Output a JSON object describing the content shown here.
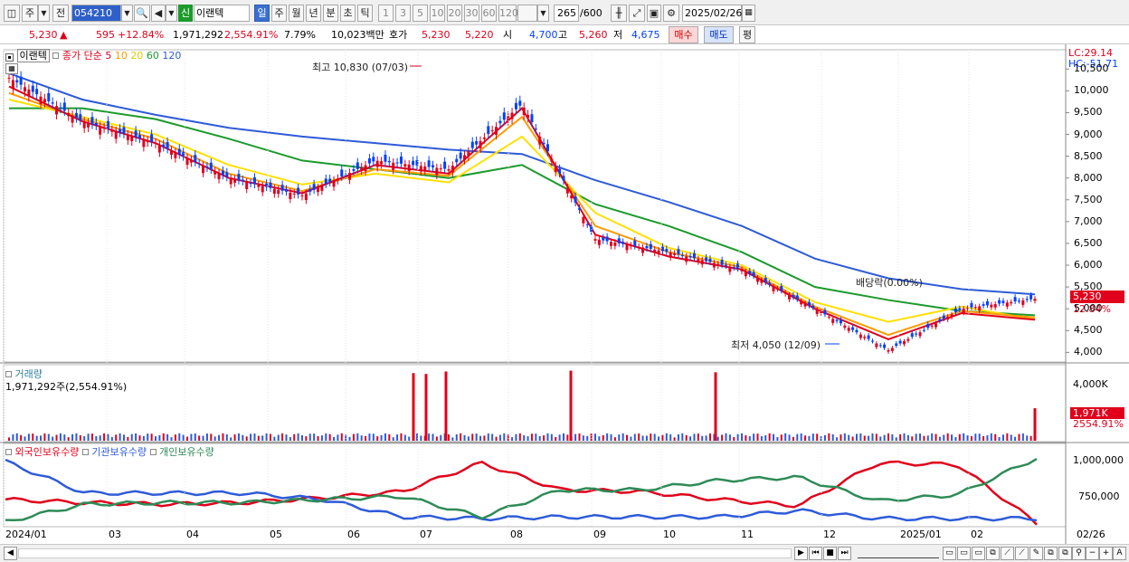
{
  "toolbar": {
    "period_main": "주",
    "period_prev": "전",
    "code": "054210",
    "badge": "신",
    "name": "이랜텍",
    "periods": [
      "일",
      "주",
      "월",
      "년",
      "분",
      "초",
      "틱"
    ],
    "counts": [
      "1",
      "3",
      "5",
      "10",
      "20",
      "30",
      "60",
      "120"
    ],
    "range": "265",
    "range_total": "/600",
    "date": "2025/02/26"
  },
  "quote": {
    "price": "5,230",
    "change": "595",
    "change_pct": "+12.84%",
    "volume": "1,971,292",
    "vol_ratio": "2,554.91%",
    "turnover": "7.79%",
    "amount": "10,023백만",
    "bid_label": "호가",
    "ask": "5,230",
    "bid": "5,220",
    "open_label": "시",
    "open": "4,700",
    "high_label": "고",
    "high": "5,260",
    "low_label": "저",
    "low": "4,675",
    "buy": "매수",
    "sell": "매도",
    "eval": "평"
  },
  "price_pane": {
    "stock": "이랜텍",
    "legend_label": "종가 단순",
    "ma": [
      {
        "p": "5",
        "c": "#e0001b"
      },
      {
        "p": "10",
        "c": "#ff9a00"
      },
      {
        "p": "20",
        "c": "#ffe000"
      },
      {
        "p": "60",
        "c": "#1c9a2c"
      },
      {
        "p": "120",
        "c": "#2e5bd8"
      }
    ],
    "lc": "LC:29.14",
    "hc": "HC:-51.71",
    "high_note": "최고 10,830 (07/03)",
    "low_note": "최저 4,050 (12/09)",
    "div_note": "배당락(0.00%)",
    "last_tag": "5,230",
    "last_pct": "12.84%",
    "y_ticks": [
      "10,500",
      "10,000",
      "9,500",
      "9,000",
      "8,500",
      "8,000",
      "7,500",
      "7,000",
      "6,500",
      "6,000",
      "5,500",
      "5,000",
      "4,500",
      "4,000"
    ]
  },
  "volume_pane": {
    "title": "거래량",
    "value": "1,971,292주(2,554.91%)",
    "tick": "4,000K",
    "last_tag": "1,971K",
    "last_pct": "2554.91%"
  },
  "holder_pane": {
    "series": [
      {
        "name": "외국인보유수량",
        "color": "#e0001b"
      },
      {
        "name": "기관보유수량",
        "color": "#2e5bd8"
      },
      {
        "name": "개인보유수량",
        "color": "#2e8b57"
      }
    ],
    "ticks": [
      "1,000,000",
      "750,000"
    ]
  },
  "x_axis": {
    "labels": [
      "2024/01",
      "03",
      "04",
      "05",
      "06",
      "07",
      "08",
      "09",
      "10",
      "11",
      "12",
      "2025/01",
      "02"
    ],
    "right_label": "02/26"
  },
  "chart_data": [
    {
      "type": "line",
      "title": "이랜텍",
      "ylim": [
        3800,
        10900
      ],
      "x": [
        "2024/01",
        "02",
        "03",
        "04",
        "05",
        "06",
        "07",
        "08",
        "09",
        "10",
        "11",
        "12",
        "2025/01",
        "02",
        "02/26"
      ],
      "series": [
        {
          "name": "종가",
          "values": [
            10300,
            9300,
            8800,
            8000,
            7600,
            8400,
            8200,
            9700,
            6600,
            6300,
            5900,
            5000,
            4050,
            5000,
            5230
          ]
        },
        {
          "name": "5",
          "values": [
            10100,
            9300,
            8800,
            8000,
            7650,
            8300,
            8100,
            9600,
            6700,
            6200,
            5900,
            5000,
            4300,
            4900,
            4750
          ]
        },
        {
          "name": "10",
          "values": [
            9950,
            9350,
            8900,
            8100,
            7700,
            8200,
            8050,
            9400,
            6900,
            6300,
            5950,
            5050,
            4400,
            4950,
            4800
          ]
        },
        {
          "name": "20",
          "values": [
            9800,
            9400,
            9000,
            8300,
            7850,
            8100,
            7900,
            8950,
            7200,
            6400,
            6000,
            5150,
            4700,
            5050,
            4750
          ]
        },
        {
          "name": "60",
          "values": [
            9600,
            9600,
            9350,
            8900,
            8400,
            8200,
            8000,
            8300,
            7400,
            6900,
            6300,
            5500,
            5200,
            4950,
            4850
          ]
        },
        {
          "name": "120",
          "values": [
            10400,
            9800,
            9450,
            9150,
            8950,
            8800,
            8650,
            8550,
            7950,
            7450,
            6900,
            6150,
            5700,
            5450,
            5330
          ]
        }
      ]
    },
    {
      "type": "bar",
      "title": "거래량",
      "x": [
        "2024/01",
        "03",
        "04",
        "05",
        "06",
        "07",
        "08",
        "09",
        "10",
        "11",
        "12",
        "2025/01",
        "02",
        "02/26"
      ],
      "ylim": [
        0,
        4500
      ],
      "spikes": [
        {
          "x": "07/03",
          "value": 4100
        },
        {
          "x": "07/05",
          "value": 4050
        },
        {
          "x": "07/10",
          "value": 4200
        },
        {
          "x": "08/27",
          "value": 4250
        },
        {
          "x": "10/24",
          "value": 4150
        },
        {
          "x": "02/26",
          "value": 1971
        }
      ],
      "ylabel": "K"
    },
    {
      "type": "line",
      "title": "보유수량",
      "ylim": [
        600000,
        1050000
      ],
      "x": [
        "2024/01",
        "03",
        "04",
        "05",
        "06",
        "07",
        "08",
        "09",
        "10",
        "11",
        "12",
        "2025/01",
        "02",
        "02/26"
      ],
      "series": [
        {
          "name": "외국인보유수량",
          "values": [
            760000,
            740000,
            730000,
            740000,
            770000,
            810000,
            990000,
            820000,
            810000,
            760000,
            720000,
            990000,
            980000,
            610000
          ]
        },
        {
          "name": "기관보유수량",
          "values": [
            1000000,
            800000,
            800000,
            800000,
            760000,
            650000,
            640000,
            650000,
            650000,
            650000,
            690000,
            640000,
            640000,
            640000
          ]
        },
        {
          "name": "개인보유수량",
          "values": [
            620000,
            730000,
            740000,
            740000,
            760000,
            780000,
            650000,
            820000,
            820000,
            880000,
            900000,
            750000,
            790000,
            1020000
          ]
        }
      ]
    }
  ]
}
